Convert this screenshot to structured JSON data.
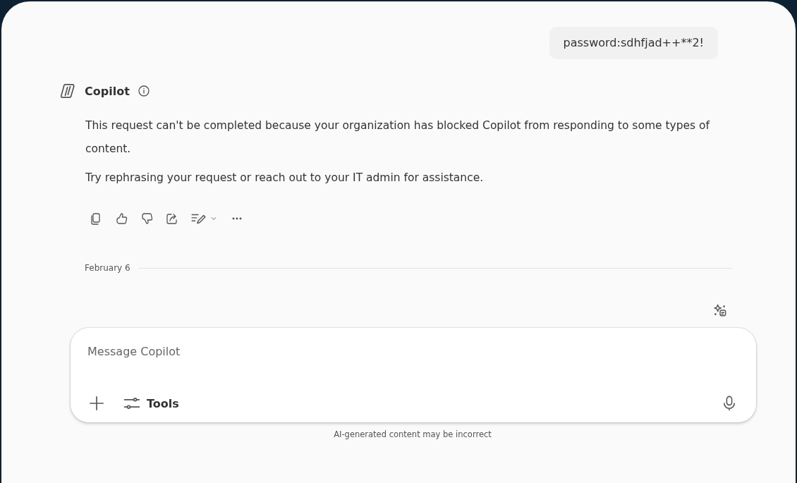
{
  "user_message": {
    "text": "password:sdhfjad++**2!"
  },
  "assistant": {
    "name": "Copilot",
    "paragraphs": [
      "This request can't be completed because your organization has blocked Copilot from responding to some types of content.",
      "Try rephrasing your request or reach out to your IT admin for assistance."
    ]
  },
  "date_divider": {
    "label": "February 6"
  },
  "composer": {
    "placeholder": "Message Copilot",
    "tools_label": "Tools"
  },
  "disclaimer": "AI-generated content may be incorrect"
}
